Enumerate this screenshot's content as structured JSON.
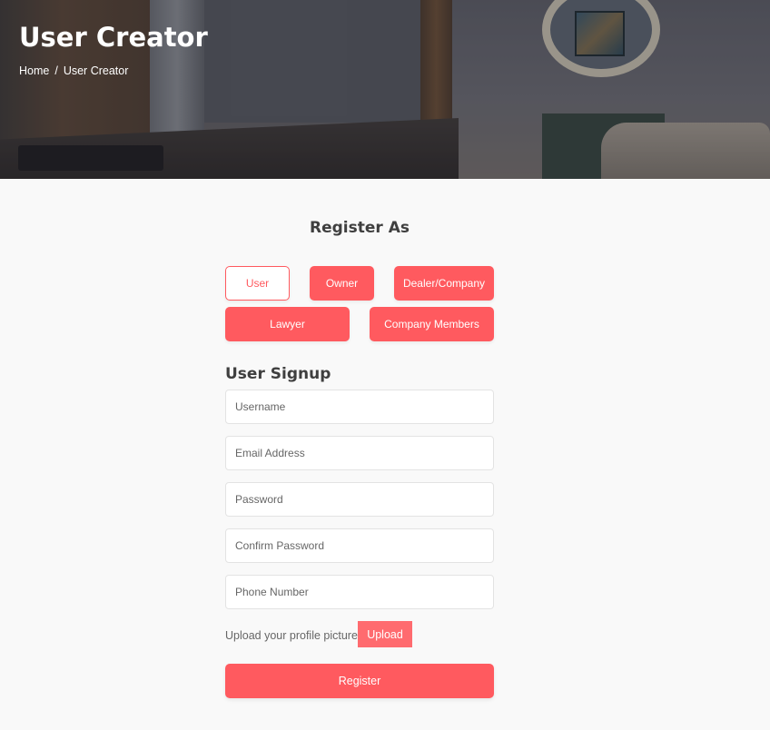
{
  "hero": {
    "title": "User Creator",
    "breadcrumb": {
      "home": "Home",
      "separator": "/",
      "current": "User Creator"
    }
  },
  "register_as": {
    "title": "Register As",
    "roles": [
      {
        "label": "User",
        "selected": true
      },
      {
        "label": "Owner",
        "selected": false
      },
      {
        "label": "Dealer/Company",
        "selected": false
      },
      {
        "label": "Lawyer",
        "selected": false
      },
      {
        "label": "Company Members",
        "selected": false
      }
    ]
  },
  "signup": {
    "title": "User Signup",
    "fields": [
      {
        "placeholder": "Username",
        "value": ""
      },
      {
        "placeholder": "Email Address",
        "value": ""
      },
      {
        "placeholder": "Password",
        "value": ""
      },
      {
        "placeholder": "Confirm Password",
        "value": ""
      },
      {
        "placeholder": "Phone Number",
        "value": ""
      }
    ],
    "upload_label": "Upload your profile picture.",
    "upload_button": "Upload",
    "register_button": "Register"
  },
  "colors": {
    "accent": "#ff5a5f",
    "background": "#f9f9f9",
    "heading": "#3f3f3f"
  }
}
